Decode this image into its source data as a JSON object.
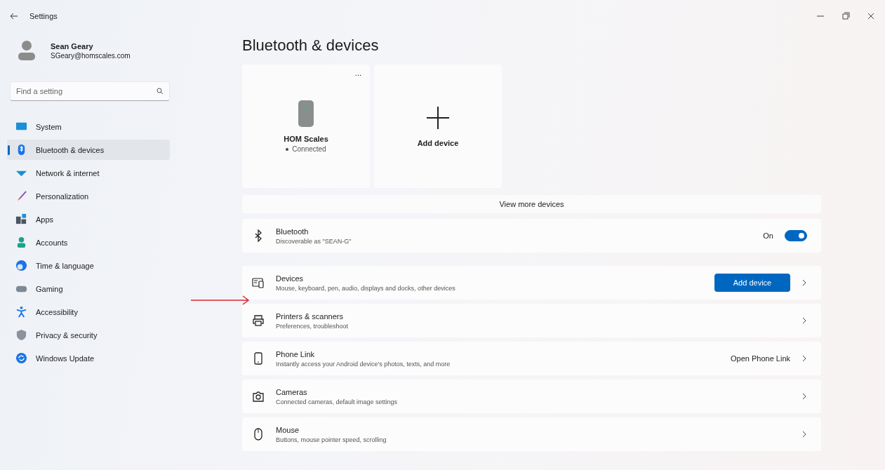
{
  "window": {
    "title": "Settings"
  },
  "profile": {
    "name": "Sean Geary",
    "email": "SGeary@homscales.com"
  },
  "search": {
    "placeholder": "Find a setting"
  },
  "sidebar": {
    "items": [
      {
        "label": "System",
        "selected": false
      },
      {
        "label": "Bluetooth & devices",
        "selected": true
      },
      {
        "label": "Network & internet",
        "selected": false
      },
      {
        "label": "Personalization",
        "selected": false
      },
      {
        "label": "Apps",
        "selected": false
      },
      {
        "label": "Accounts",
        "selected": false
      },
      {
        "label": "Time & language",
        "selected": false
      },
      {
        "label": "Gaming",
        "selected": false
      },
      {
        "label": "Accessibility",
        "selected": false
      },
      {
        "label": "Privacy & security",
        "selected": false
      },
      {
        "label": "Windows Update",
        "selected": false
      }
    ]
  },
  "page_title": "Bluetooth & devices",
  "device_cards": [
    {
      "kind": "device",
      "name": "HOM Scales",
      "status": "Connected",
      "menu": "..."
    },
    {
      "kind": "add",
      "name": "Add device"
    }
  ],
  "view_more": "View more devices",
  "rows": [
    {
      "title": "Bluetooth",
      "subtitle": "Discoverable as \"SEAN-G\"",
      "toggle": {
        "label": "On",
        "on": true
      }
    },
    {
      "title": "Devices",
      "subtitle": "Mouse, keyboard, pen, audio, displays and docks, other devices",
      "button": "Add device",
      "chevron": true
    },
    {
      "title": "Printers & scanners",
      "subtitle": "Preferences, troubleshoot",
      "chevron": true
    },
    {
      "title": "Phone Link",
      "subtitle": "Instantly access your Android device's photos, texts, and more",
      "link": "Open Phone Link",
      "chevron": true
    },
    {
      "title": "Cameras",
      "subtitle": "Connected cameras, default image settings",
      "chevron": true
    },
    {
      "title": "Mouse",
      "subtitle": "Buttons, mouse pointer speed, scrolling",
      "chevron": true
    }
  ]
}
